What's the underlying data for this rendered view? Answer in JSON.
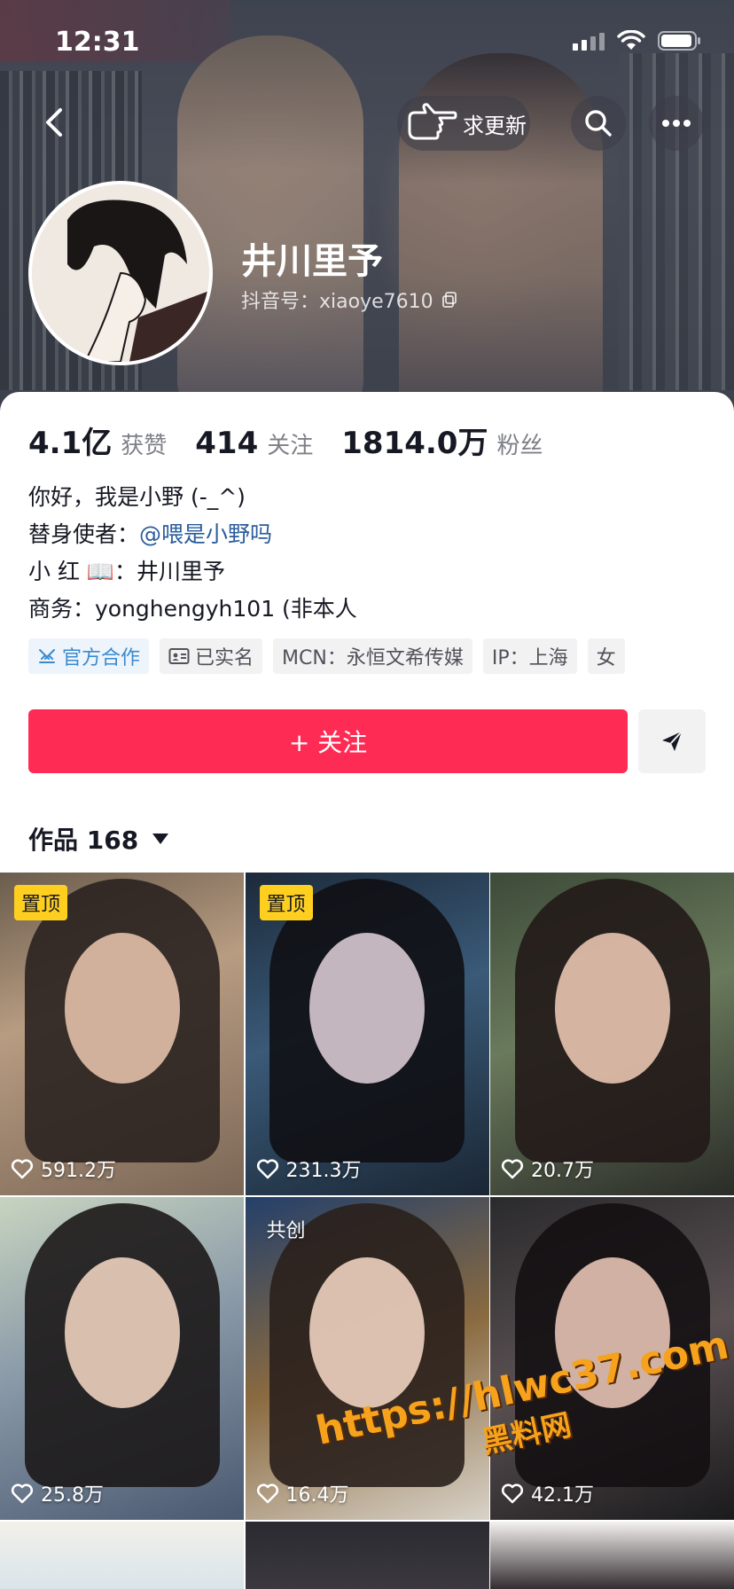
{
  "status_bar": {
    "time": "12:31"
  },
  "nav": {
    "update_label": "求更新"
  },
  "profile": {
    "name": "井川里予",
    "douyin_id": "抖音号：xiaoye7610"
  },
  "stats": [
    {
      "num": "4.1亿",
      "unit": "获赞"
    },
    {
      "num": "414",
      "unit": "关注"
    },
    {
      "num": "1814.0万",
      "unit": "粉丝"
    }
  ],
  "bio": {
    "line1": "你好，我是小野 (-_^)",
    "line2_prefix": "替身使者：",
    "line2_mention": "@喂是小野吗",
    "line3": "小 红 📖：井川里予",
    "line4": "商务：yonghengyh101 (非本人"
  },
  "tags": {
    "official": "官方合作",
    "verified": "已实名",
    "mcn": "MCN：永恒文希传媒",
    "ip": "IP：上海",
    "gender": "女"
  },
  "actions": {
    "follow_label": "+ 关注"
  },
  "works": {
    "label": "作品 168"
  },
  "videos": [
    {
      "likes": "591.2万",
      "badge": "置顶"
    },
    {
      "likes": "231.3万",
      "badge": "置顶"
    },
    {
      "likes": "20.7万"
    },
    {
      "likes": "25.8万"
    },
    {
      "likes": "16.4万",
      "co_badge": "共创"
    },
    {
      "likes": "42.1万"
    }
  ],
  "watermark": {
    "line1": "https://hlwc37.com",
    "line2": "黑料网"
  },
  "colors": {
    "accent": "#fe2c55",
    "mention": "#2b5d9c",
    "pin_badge": "#ffcf20",
    "official_tag": "#3a8ad0"
  }
}
